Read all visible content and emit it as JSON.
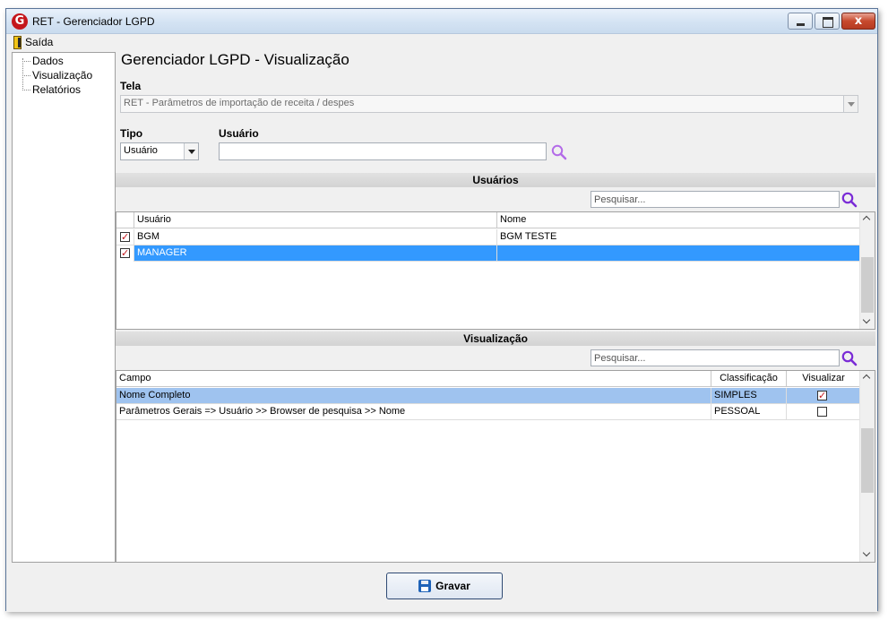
{
  "window": {
    "title": "RET - Gerenciador LGPD",
    "icon_letter": "G",
    "close_glyph": "x"
  },
  "menu": {
    "exit_label": "Saída"
  },
  "tree": {
    "items": [
      "Dados",
      "Visualização",
      "Relatórios"
    ]
  },
  "page": {
    "title": "Gerenciador LGPD - Visualização"
  },
  "tela": {
    "label": "Tela",
    "value": "RET - Parâmetros de importação de receita / despes"
  },
  "tipo": {
    "label": "Tipo",
    "value": "Usuário"
  },
  "usuario": {
    "label": "Usuário",
    "value": ""
  },
  "users_section": {
    "title": "Usuários",
    "search_placeholder": "Pesquisar...",
    "columns": [
      "Usuário",
      "Nome"
    ],
    "rows": [
      {
        "checked": true,
        "usuario": "BGM",
        "nome": "BGM TESTE"
      },
      {
        "checked": true,
        "usuario": "MANAGER",
        "nome": ""
      }
    ]
  },
  "view_section": {
    "title": "Visualização",
    "search_placeholder": "Pesquisar...",
    "columns": [
      "Campo",
      "Classificação",
      "Visualizar"
    ],
    "rows": [
      {
        "campo": "Nome Completo",
        "classificacao": "SIMPLES",
        "visualizar": true
      },
      {
        "campo": "Parâmetros Gerais => Usuário >> Browser de pesquisa >> Nome",
        "classificacao": "PESSOAL",
        "visualizar": false
      }
    ]
  },
  "footer": {
    "save_label": "Gravar"
  },
  "colors": {
    "accent_red": "#c4161c",
    "selection_blue": "#3399ff",
    "selection_light": "#9fc3ef",
    "search_purple": "#7a2bd6"
  }
}
